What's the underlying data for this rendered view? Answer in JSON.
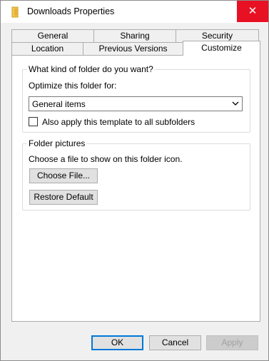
{
  "window": {
    "title": "Downloads Properties",
    "close_glyph": "✕",
    "icon": "folder-icon"
  },
  "tabs": {
    "row1": [
      "General",
      "Sharing",
      "Security"
    ],
    "row2": [
      "Location",
      "Previous Versions",
      "Customize"
    ],
    "active": "Customize"
  },
  "folder_kind": {
    "legend": "What kind of folder do you want?",
    "optimize_label": "Optimize this folder for:",
    "selected_value": "General items",
    "apply_subfolders_label": "Also apply this template to all subfolders",
    "apply_subfolders_checked": false
  },
  "folder_pictures": {
    "legend": "Folder pictures",
    "description": "Choose a file to show on this folder icon.",
    "choose_file_label": "Choose File...",
    "restore_default_label": "Restore Default"
  },
  "footer": {
    "ok_label": "OK",
    "cancel_label": "Cancel",
    "apply_label": "Apply"
  },
  "colors": {
    "close_button": "#e81123",
    "default_button_border": "#0078d7"
  }
}
